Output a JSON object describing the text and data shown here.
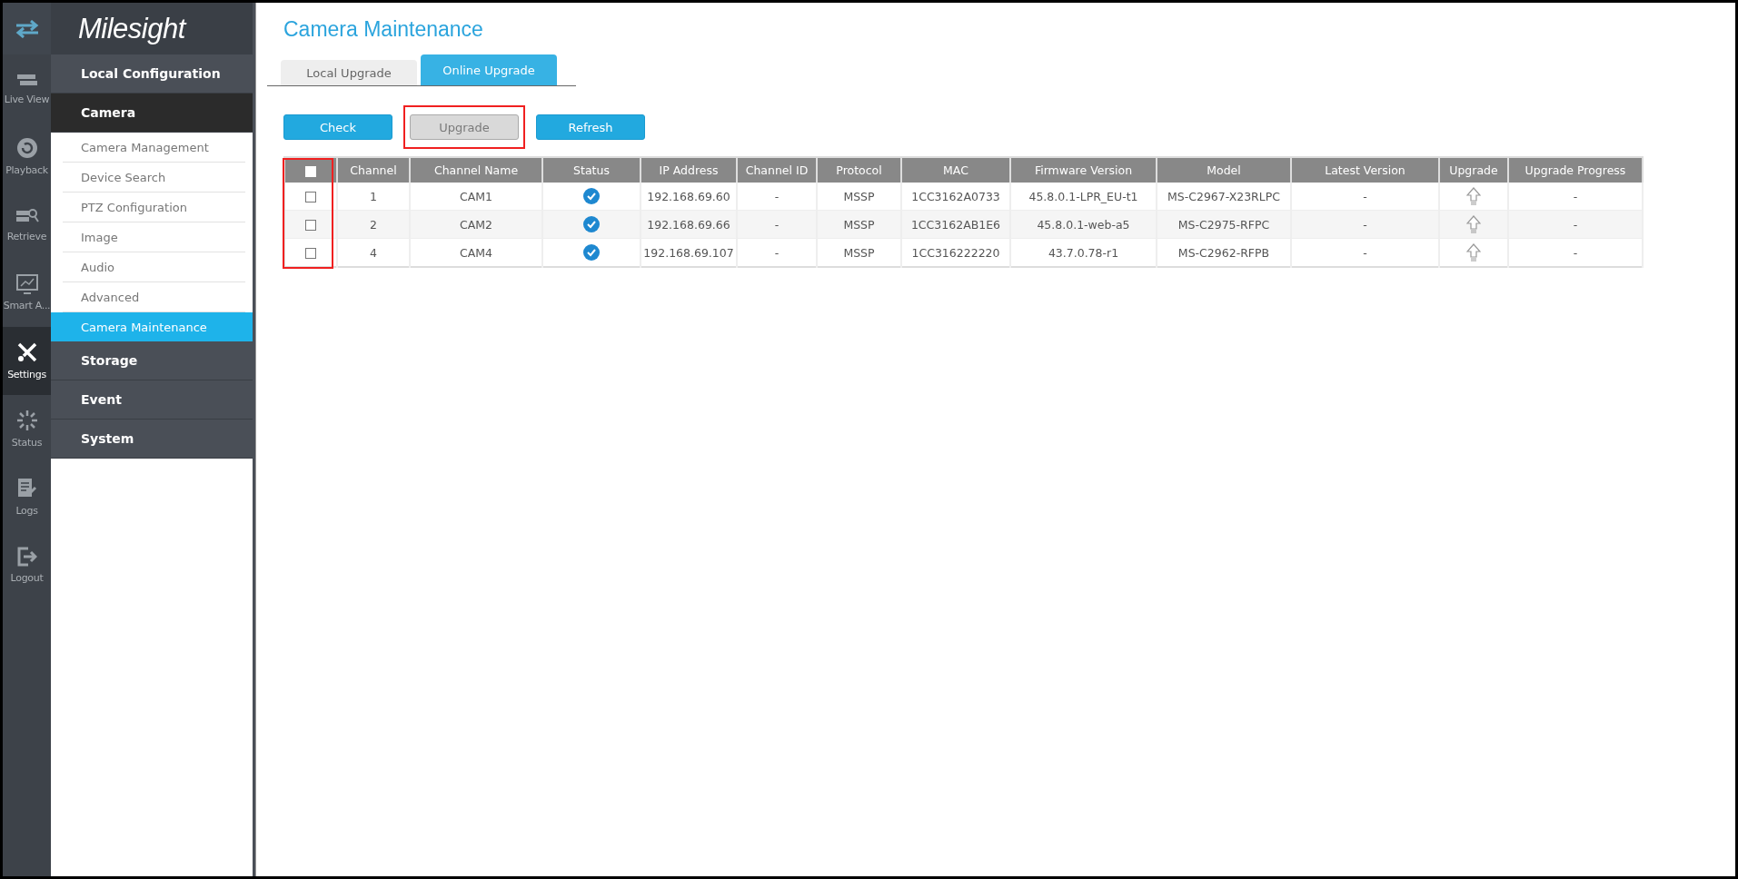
{
  "nav_rail": [
    {
      "kind": "toggle",
      "selected": false
    },
    {
      "label": "Live View",
      "kind": "live",
      "selected": false
    },
    {
      "label": "Playback",
      "kind": "playback",
      "selected": false
    },
    {
      "label": "Retrieve",
      "kind": "retrieve",
      "selected": false
    },
    {
      "label": "Smart A...",
      "kind": "smart",
      "selected": false
    },
    {
      "label": "Settings",
      "kind": "settings",
      "selected": true
    },
    {
      "label": "Status",
      "kind": "status",
      "selected": false
    },
    {
      "label": "Logs",
      "kind": "logs",
      "selected": false
    },
    {
      "label": "Logout",
      "kind": "logout",
      "selected": false
    }
  ],
  "logo": "Milesight",
  "sidebar": {
    "groups": [
      {
        "label": "Local Configuration",
        "expanded": false
      },
      {
        "label": "Camera",
        "expanded": true,
        "children": [
          {
            "label": "Camera Management",
            "selected": false
          },
          {
            "label": "Device Search",
            "selected": false
          },
          {
            "label": "PTZ Configuration",
            "selected": false
          },
          {
            "label": "Image",
            "selected": false
          },
          {
            "label": "Audio",
            "selected": false
          },
          {
            "label": "Advanced",
            "selected": false
          },
          {
            "label": "Camera Maintenance",
            "selected": true
          }
        ]
      },
      {
        "label": "Storage",
        "expanded": false
      },
      {
        "label": "Event",
        "expanded": false
      },
      {
        "label": "System",
        "expanded": false
      }
    ]
  },
  "page_title": "Camera Maintenance",
  "tabs": [
    {
      "label": "Local Upgrade",
      "selected": false
    },
    {
      "label": "Online Upgrade",
      "selected": true
    }
  ],
  "buttons": [
    {
      "label": "Check",
      "disabled": false,
      "highlighted": false
    },
    {
      "label": "Upgrade",
      "disabled": true,
      "highlighted": true
    },
    {
      "label": "Refresh",
      "disabled": false,
      "highlighted": false
    }
  ],
  "table": {
    "select_all_checked": false,
    "select_column_highlighted": true,
    "columns": [
      "Channel",
      "Channel Name",
      "Status",
      "IP Address",
      "Channel ID",
      "Protocol",
      "MAC",
      "Firmware Version",
      "Model",
      "Latest Version",
      "Upgrade",
      "Upgrade Progress"
    ],
    "rows": [
      {
        "checked": false,
        "channel": "1",
        "name": "CAM1",
        "online": true,
        "ip": "192.168.69.60",
        "channel_id": "-",
        "protocol": "MSSP",
        "mac": "1CC3162A0733",
        "firmware": "45.8.0.1-LPR_EU-t1",
        "model": "MS-C2967-X23RLPC",
        "latest": "-",
        "progress": "-"
      },
      {
        "checked": false,
        "channel": "2",
        "name": "CAM2",
        "online": true,
        "ip": "192.168.69.66",
        "channel_id": "-",
        "protocol": "MSSP",
        "mac": "1CC3162AB1E6",
        "firmware": "45.8.0.1-web-a5",
        "model": "MS-C2975-RFPC",
        "latest": "-",
        "progress": "-"
      },
      {
        "checked": false,
        "channel": "4",
        "name": "CAM4",
        "online": true,
        "ip": "192.168.69.107",
        "channel_id": "-",
        "protocol": "MSSP",
        "mac": "1CC316222220",
        "firmware": "43.7.0.78-r1",
        "model": "MS-C2962-RFPB",
        "latest": "-",
        "progress": "-"
      }
    ]
  }
}
